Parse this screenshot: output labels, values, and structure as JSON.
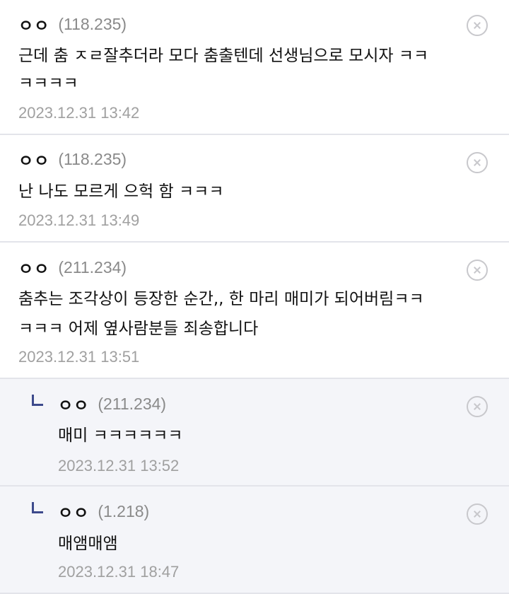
{
  "comments": [
    {
      "author": "ㅇㅇ",
      "ip": "(118.235)",
      "lines": [
        "근데 춤 ㅈㄹ잘추더라 모다 춤출텐데 선생님으로 모시자 ㅋㅋ",
        "ㅋㅋㅋㅋ"
      ],
      "date": "2023.12.31 13:42",
      "is_reply": false
    },
    {
      "author": "ㅇㅇ",
      "ip": "(118.235)",
      "lines": [
        "난 나도 모르게 으헉 함 ㅋㅋㅋ"
      ],
      "date": "2023.12.31 13:49",
      "is_reply": false
    },
    {
      "author": "ㅇㅇ",
      "ip": "(211.234)",
      "lines": [
        "춤추는 조각상이 등장한 순간,, 한 마리 매미가 되어버림ㅋㅋ",
        "ㅋㅋㅋ 어제 옆사람분들 죄송합니다"
      ],
      "date": "2023.12.31 13:51",
      "is_reply": false
    },
    {
      "author": "ㅇㅇ",
      "ip": "(211.234)",
      "lines": [
        "매미 ㅋㅋㅋㅋㅋㅋ"
      ],
      "date": "2023.12.31 13:52",
      "is_reply": true
    },
    {
      "author": "ㅇㅇ",
      "ip": "(1.218)",
      "lines": [
        "매앰매앰"
      ],
      "date": "2023.12.31 18:47",
      "is_reply": true
    }
  ],
  "icons": {
    "delete": "circle-x-icon",
    "reply": "reply-corner-icon"
  },
  "colors": {
    "reply_marker": "#3d4a8c",
    "reply_background": "#f4f5f9",
    "ip": "#8a8a8a",
    "date": "#a0a0a0",
    "divider": "#e3e4ea"
  }
}
